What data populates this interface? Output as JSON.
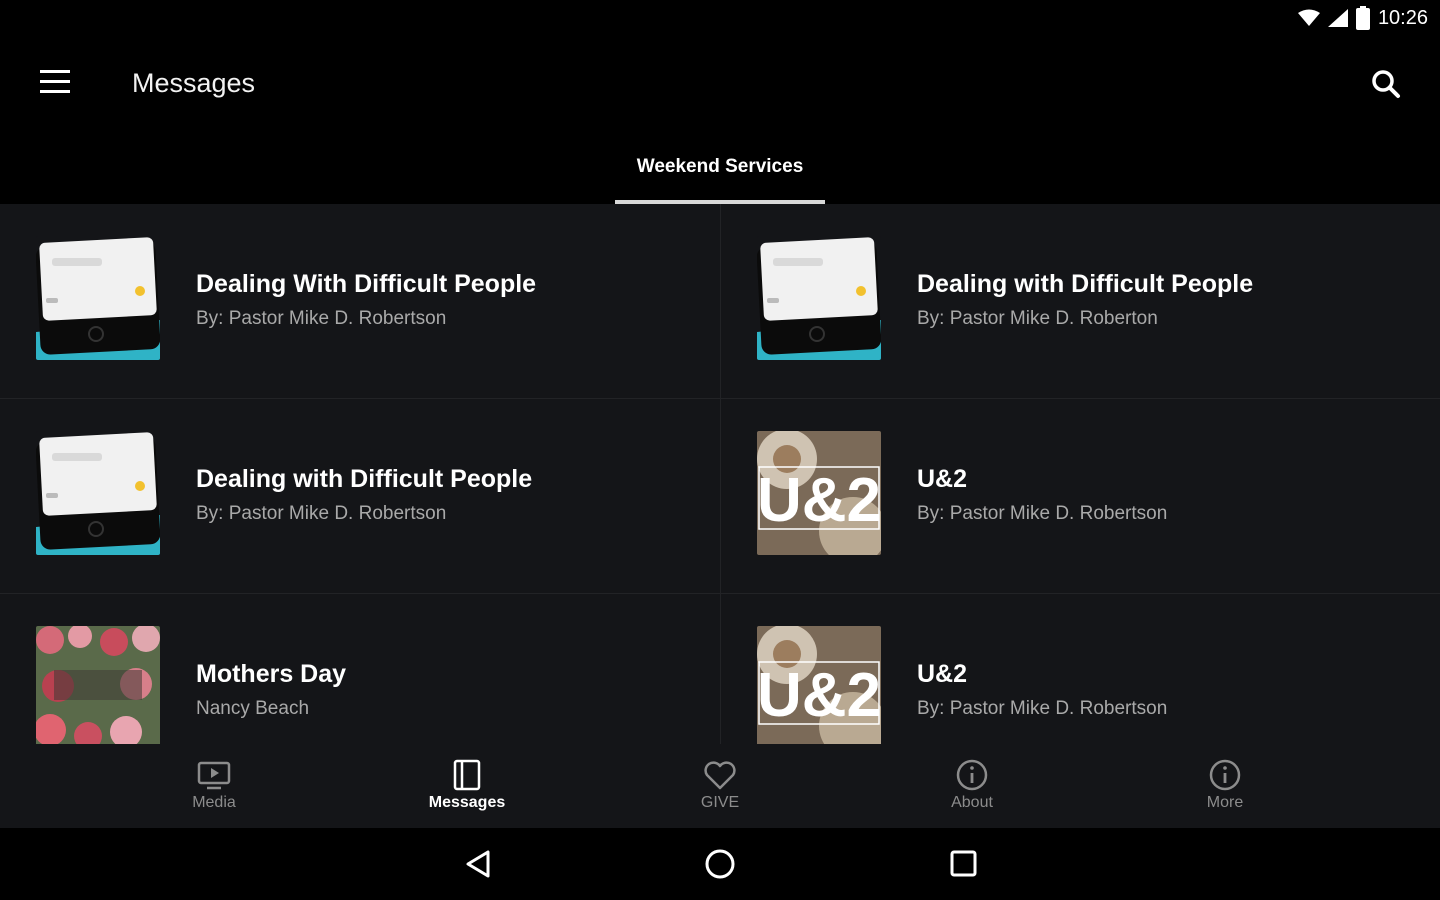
{
  "status": {
    "time": "10:26"
  },
  "appbar": {
    "title": "Messages"
  },
  "tabs": [
    {
      "label": "Weekend Services",
      "active": true
    }
  ],
  "items": [
    {
      "title": "Dealing With Difficult People",
      "subtitle": "By: Pastor Mike D. Robertson",
      "thumb": "phone"
    },
    {
      "title": "Dealing with Difficult People",
      "subtitle": "By: Pastor Mike D. Roberton",
      "thumb": "phone"
    },
    {
      "title": "Dealing with Difficult People",
      "subtitle": "By: Pastor Mike D. Robertson",
      "thumb": "phone"
    },
    {
      "title": "U&2",
      "subtitle": "By: Pastor Mike D. Robertson",
      "thumb": "u2"
    },
    {
      "title": "Mothers Day",
      "subtitle": "Nancy Beach",
      "thumb": "flowers"
    },
    {
      "title": "U&2",
      "subtitle": "By: Pastor Mike D. Robertson",
      "thumb": "u2"
    }
  ],
  "thumb_text": {
    "u2": "U&2"
  },
  "bottom_nav": [
    {
      "label": "Media",
      "icon": "tv-icon"
    },
    {
      "label": "Messages",
      "icon": "book-icon",
      "active": true
    },
    {
      "label": "GIVE",
      "icon": "heart-icon"
    },
    {
      "label": "About",
      "icon": "info-icon"
    },
    {
      "label": "More",
      "icon": "info-icon"
    }
  ],
  "colors": {
    "accent_teal": "#2fb3c6",
    "u2_blue": "#37b8e8",
    "background": "#141518"
  }
}
